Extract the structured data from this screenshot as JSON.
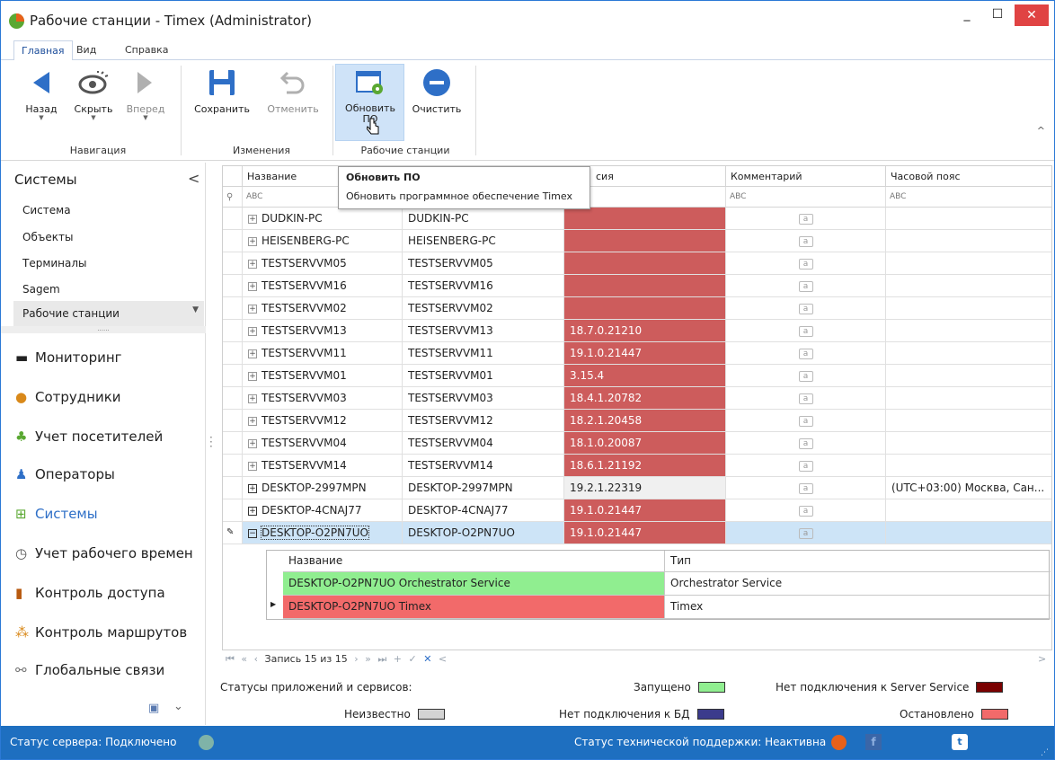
{
  "window": {
    "title": "Рабочие станции - Timex (Administrator)",
    "min": "_",
    "max": "☐",
    "close": "✕"
  },
  "tabs": [
    "Главная",
    "Вид",
    "Справка"
  ],
  "ribbon": {
    "back": "Назад",
    "hide": "Скрыть",
    "forward": "Вперед",
    "save": "Сохранить",
    "cancel": "Отменить",
    "update_sw_1": "Обновить",
    "update_sw_2": "ПО",
    "clear": "Очистить",
    "group_nav": "Навигация",
    "group_changes": "Изменения",
    "group_ws": "Рабочие станции",
    "collapse": "^"
  },
  "tooltip": {
    "title": "Обновить ПО",
    "text": "Обновить программное обеспечение Timex"
  },
  "sidebar": {
    "header": "Системы",
    "collapse": "<",
    "items": [
      "Система",
      "Объекты",
      "Терминалы",
      "Sagem",
      "Рабочие станции"
    ],
    "dots": "......",
    "nav": [
      {
        "label": "Мониторинг",
        "icon": "monitor-icon"
      },
      {
        "label": "Сотрудники",
        "icon": "employees-icon"
      },
      {
        "label": "Учет посетителей",
        "icon": "visitors-icon"
      },
      {
        "label": "Операторы",
        "icon": "operators-icon"
      },
      {
        "label": "Системы",
        "icon": "systems-icon"
      },
      {
        "label": "Учет рабочего времен",
        "icon": "clock-icon"
      },
      {
        "label": "Контроль доступа",
        "icon": "door-icon"
      },
      {
        "label": "Контроль маршрутов",
        "icon": "route-icon"
      },
      {
        "label": "Глобальные связи",
        "icon": "link-icon"
      }
    ],
    "more": "⌄"
  },
  "grid": {
    "columns": [
      "Название",
      "",
      "сия",
      "Комментарий",
      "Часовой пояс"
    ],
    "filter": "ABC",
    "rows": [
      {
        "name": "DUDKIN-PC",
        "host": "DUDKIN-PC",
        "version": "",
        "status": "red",
        "tz": "",
        "exp": "+"
      },
      {
        "name": "HEISENBERG-PC",
        "host": "HEISENBERG-PC",
        "version": "",
        "status": "red",
        "tz": "",
        "exp": "+"
      },
      {
        "name": "TESTSERVVM05",
        "host": "TESTSERVVM05",
        "version": "",
        "status": "red",
        "tz": "",
        "exp": "+"
      },
      {
        "name": "TESTSERVVM16",
        "host": "TESTSERVVM16",
        "version": "",
        "status": "red",
        "tz": "",
        "exp": "+"
      },
      {
        "name": "TESTSERVVM02",
        "host": "TESTSERVVM02",
        "version": "",
        "status": "red",
        "tz": "",
        "exp": "+"
      },
      {
        "name": "TESTSERVVM13",
        "host": "TESTSERVVM13",
        "version": "18.7.0.21210",
        "status": "red",
        "tz": "",
        "exp": "+"
      },
      {
        "name": "TESTSERVVM11",
        "host": "TESTSERVVM11",
        "version": "19.1.0.21447",
        "status": "red",
        "tz": "",
        "exp": "+"
      },
      {
        "name": "TESTSERVVM01",
        "host": "TESTSERVVM01",
        "version": "3.15.4",
        "status": "red",
        "tz": "",
        "exp": "+"
      },
      {
        "name": "TESTSERVVM03",
        "host": "TESTSERVVM03",
        "version": "18.4.1.20782",
        "status": "red",
        "tz": "",
        "exp": "+"
      },
      {
        "name": "TESTSERVVM12",
        "host": "TESTSERVVM12",
        "version": "18.2.1.20458",
        "status": "red",
        "tz": "",
        "exp": "+"
      },
      {
        "name": "TESTSERVVM04",
        "host": "TESTSERVVM04",
        "version": "18.1.0.20087",
        "status": "red",
        "tz": "",
        "exp": "+"
      },
      {
        "name": "TESTSERVVM14",
        "host": "TESTSERVVM14",
        "version": "18.6.1.21192",
        "status": "red",
        "tz": "",
        "exp": "+"
      },
      {
        "name": "DESKTOP-2997MPN",
        "host": "DESKTOP-2997MPN",
        "version": "19.2.1.22319",
        "status": "gray",
        "tz": "(UTC+03:00) Москва, Сан...",
        "exp": "+"
      },
      {
        "name": "DESKTOP-4CNAJ77",
        "host": "DESKTOP-4CNAJ77",
        "version": "19.1.0.21447",
        "status": "red",
        "tz": "",
        "exp": "+"
      },
      {
        "name": "DESKTOP-O2PN7UO",
        "host": "DESKTOP-O2PN7UO",
        "version": "19.1.0.21447",
        "status": "red",
        "tz": "",
        "exp": "−"
      }
    ],
    "comment_icon": "a",
    "detail": {
      "columns": [
        "Название",
        "Тип"
      ],
      "rows": [
        {
          "name": "DESKTOP-O2PN7UO Orchestrator Service",
          "type": "Orchestrator Service",
          "color": "#90ee90"
        },
        {
          "name": "DESKTOP-O2PN7UO Timex",
          "type": "Timex",
          "color": "#f26a6a"
        }
      ]
    },
    "pager": {
      "first": "⏮",
      "prevpage": "«",
      "prev": "‹",
      "record": "Запись 15 из 15",
      "next": "›",
      "nextpage": "»",
      "last": "⏭",
      "add": "+",
      "ok": "✓",
      "del": "✕",
      "left": "<",
      "right": ">"
    }
  },
  "legend": {
    "title": "Статусы приложений и сервисов:",
    "running": "Запущено",
    "running_color": "#90ee90",
    "no_server": "Нет подключения к Server Service",
    "no_server_color": "#7a0000",
    "unknown": "Неизвестно",
    "unknown_color": "#d3d3d3",
    "no_db": "Нет подключения к БД",
    "no_db_color": "#3b3b8c",
    "stopped": "Остановлено",
    "stopped_color": "#f26a6a"
  },
  "status": {
    "server": "Статус сервера: Подключено",
    "server_color": "#7fb3a8",
    "support": "Статус технической поддержки: Неактивна",
    "support_color": "#e8611a"
  }
}
